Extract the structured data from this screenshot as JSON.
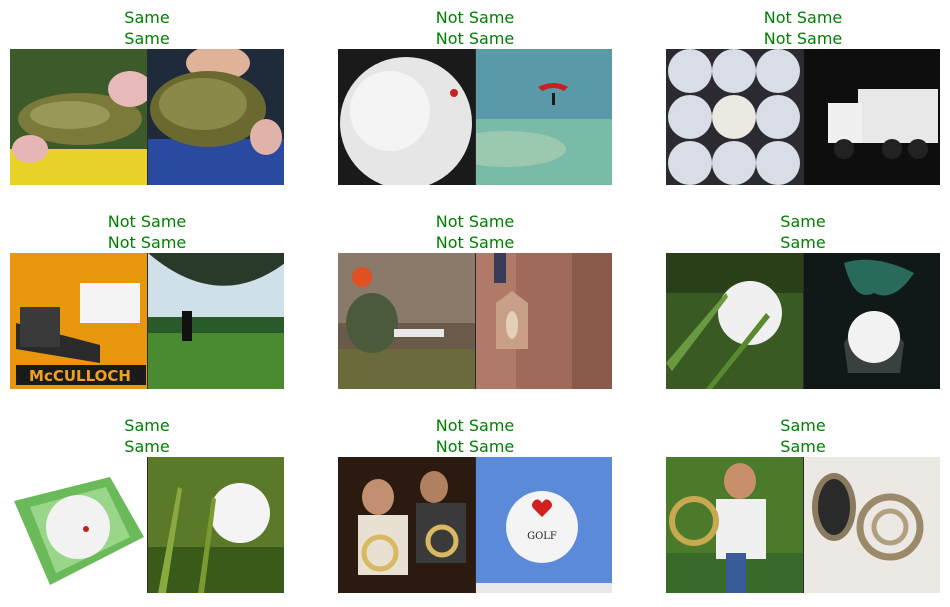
{
  "cells": [
    {
      "label_true": "Same",
      "label_pred": "Same",
      "images": [
        "fish-held",
        "fish-held-large"
      ]
    },
    {
      "label_true": "Not Same",
      "label_pred": "Not Same",
      "images": [
        "golf-ball-closeup",
        "parachute-sky"
      ]
    },
    {
      "label_true": "Not Same",
      "label_pred": "Not Same",
      "images": [
        "golf-balls-grid",
        "garbage-truck"
      ]
    },
    {
      "label_true": "Not Same",
      "label_pred": "Not Same",
      "images": [
        "chainsaw-box",
        "parachute-field"
      ]
    },
    {
      "label_true": "Not Same",
      "label_pred": "Not Same",
      "images": [
        "chainsaw-worker",
        "church-facade"
      ]
    },
    {
      "label_true": "Same",
      "label_pred": "Same",
      "images": [
        "golf-ball-grass",
        "golf-ball-tee-dark"
      ]
    },
    {
      "label_true": "Same",
      "label_pred": "Same",
      "images": [
        "golf-ball-package",
        "golf-ball-grass-2"
      ]
    },
    {
      "label_true": "Not Same",
      "label_pred": "Not Same",
      "images": [
        "french-horn-players",
        "golf-ball-heart"
      ]
    },
    {
      "label_true": "Same",
      "label_pred": "Same",
      "images": [
        "french-horn-boy",
        "french-horn-white"
      ]
    }
  ],
  "text": {
    "golf_heart": "GOLF",
    "chainsaw_brand": "McCULLOCH"
  },
  "colors": {
    "title": "#008000"
  }
}
